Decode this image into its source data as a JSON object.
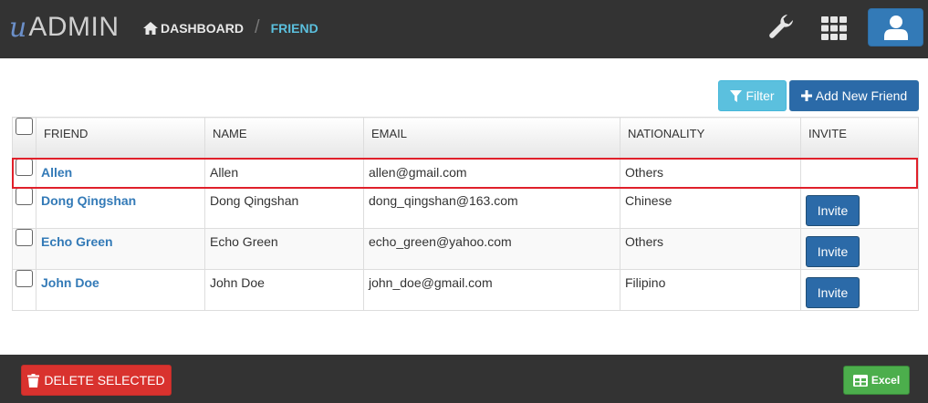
{
  "header": {
    "logo_u": "u",
    "logo_text": "ADMIN",
    "breadcrumb_home": "Dashboard",
    "breadcrumb_separator": "/",
    "breadcrumb_current": "Friend"
  },
  "toolbar": {
    "filter_label": "Filter",
    "add_label": "Add New Friend"
  },
  "table": {
    "columns": [
      "Friend",
      "Name",
      "Email",
      "Nationality",
      "Invite"
    ],
    "rows": [
      {
        "friend": "Allen",
        "name": "Allen",
        "email": "allen@gmail.com",
        "nationality": "Others",
        "invite": ""
      },
      {
        "friend": "Dong Qingshan",
        "name": "Dong Qingshan",
        "email": "dong_qingshan@163.com",
        "nationality": "Chinese",
        "invite": "Invite"
      },
      {
        "friend": "Echo Green",
        "name": "Echo Green",
        "email": "echo_green@yahoo.com",
        "nationality": "Others",
        "invite": "Invite"
      },
      {
        "friend": "John Doe",
        "name": "John Doe",
        "email": "john_doe@gmail.com",
        "nationality": "Filipino",
        "invite": "Invite"
      }
    ]
  },
  "footer": {
    "delete_label": "Delete Selected",
    "excel_label": "Excel"
  },
  "colors": {
    "topbar": "#333333",
    "primary": "#337ab7",
    "info": "#5bc0de",
    "danger": "#d9322e",
    "success": "#4cae4c",
    "highlight": "#e0202a"
  },
  "icons": {
    "home": "home-icon",
    "wrench": "wrench-icon",
    "grid": "grid-icon",
    "user": "user-icon",
    "filter": "filter-icon",
    "plus": "plus-icon",
    "trash": "trash-icon",
    "excel": "table-icon"
  }
}
